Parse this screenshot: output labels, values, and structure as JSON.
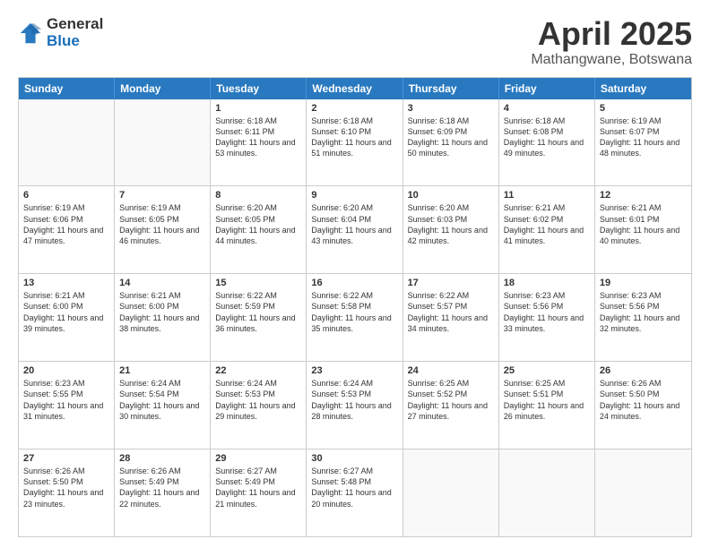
{
  "header": {
    "logo_general": "General",
    "logo_blue": "Blue",
    "month_title": "April 2025",
    "subtitle": "Mathangwane, Botswana"
  },
  "days_of_week": [
    "Sunday",
    "Monday",
    "Tuesday",
    "Wednesday",
    "Thursday",
    "Friday",
    "Saturday"
  ],
  "weeks": [
    [
      {
        "day": "",
        "empty": true
      },
      {
        "day": "",
        "empty": true
      },
      {
        "day": "1",
        "sunrise": "6:18 AM",
        "sunset": "6:11 PM",
        "daylight": "11 hours and 53 minutes."
      },
      {
        "day": "2",
        "sunrise": "6:18 AM",
        "sunset": "6:10 PM",
        "daylight": "11 hours and 51 minutes."
      },
      {
        "day": "3",
        "sunrise": "6:18 AM",
        "sunset": "6:09 PM",
        "daylight": "11 hours and 50 minutes."
      },
      {
        "day": "4",
        "sunrise": "6:18 AM",
        "sunset": "6:08 PM",
        "daylight": "11 hours and 49 minutes."
      },
      {
        "day": "5",
        "sunrise": "6:19 AM",
        "sunset": "6:07 PM",
        "daylight": "11 hours and 48 minutes."
      }
    ],
    [
      {
        "day": "6",
        "sunrise": "6:19 AM",
        "sunset": "6:06 PM",
        "daylight": "11 hours and 47 minutes."
      },
      {
        "day": "7",
        "sunrise": "6:19 AM",
        "sunset": "6:05 PM",
        "daylight": "11 hours and 46 minutes."
      },
      {
        "day": "8",
        "sunrise": "6:20 AM",
        "sunset": "6:05 PM",
        "daylight": "11 hours and 44 minutes."
      },
      {
        "day": "9",
        "sunrise": "6:20 AM",
        "sunset": "6:04 PM",
        "daylight": "11 hours and 43 minutes."
      },
      {
        "day": "10",
        "sunrise": "6:20 AM",
        "sunset": "6:03 PM",
        "daylight": "11 hours and 42 minutes."
      },
      {
        "day": "11",
        "sunrise": "6:21 AM",
        "sunset": "6:02 PM",
        "daylight": "11 hours and 41 minutes."
      },
      {
        "day": "12",
        "sunrise": "6:21 AM",
        "sunset": "6:01 PM",
        "daylight": "11 hours and 40 minutes."
      }
    ],
    [
      {
        "day": "13",
        "sunrise": "6:21 AM",
        "sunset": "6:00 PM",
        "daylight": "11 hours and 39 minutes."
      },
      {
        "day": "14",
        "sunrise": "6:21 AM",
        "sunset": "6:00 PM",
        "daylight": "11 hours and 38 minutes."
      },
      {
        "day": "15",
        "sunrise": "6:22 AM",
        "sunset": "5:59 PM",
        "daylight": "11 hours and 36 minutes."
      },
      {
        "day": "16",
        "sunrise": "6:22 AM",
        "sunset": "5:58 PM",
        "daylight": "11 hours and 35 minutes."
      },
      {
        "day": "17",
        "sunrise": "6:22 AM",
        "sunset": "5:57 PM",
        "daylight": "11 hours and 34 minutes."
      },
      {
        "day": "18",
        "sunrise": "6:23 AM",
        "sunset": "5:56 PM",
        "daylight": "11 hours and 33 minutes."
      },
      {
        "day": "19",
        "sunrise": "6:23 AM",
        "sunset": "5:56 PM",
        "daylight": "11 hours and 32 minutes."
      }
    ],
    [
      {
        "day": "20",
        "sunrise": "6:23 AM",
        "sunset": "5:55 PM",
        "daylight": "11 hours and 31 minutes."
      },
      {
        "day": "21",
        "sunrise": "6:24 AM",
        "sunset": "5:54 PM",
        "daylight": "11 hours and 30 minutes."
      },
      {
        "day": "22",
        "sunrise": "6:24 AM",
        "sunset": "5:53 PM",
        "daylight": "11 hours and 29 minutes."
      },
      {
        "day": "23",
        "sunrise": "6:24 AM",
        "sunset": "5:53 PM",
        "daylight": "11 hours and 28 minutes."
      },
      {
        "day": "24",
        "sunrise": "6:25 AM",
        "sunset": "5:52 PM",
        "daylight": "11 hours and 27 minutes."
      },
      {
        "day": "25",
        "sunrise": "6:25 AM",
        "sunset": "5:51 PM",
        "daylight": "11 hours and 26 minutes."
      },
      {
        "day": "26",
        "sunrise": "6:26 AM",
        "sunset": "5:50 PM",
        "daylight": "11 hours and 24 minutes."
      }
    ],
    [
      {
        "day": "27",
        "sunrise": "6:26 AM",
        "sunset": "5:50 PM",
        "daylight": "11 hours and 23 minutes."
      },
      {
        "day": "28",
        "sunrise": "6:26 AM",
        "sunset": "5:49 PM",
        "daylight": "11 hours and 22 minutes."
      },
      {
        "day": "29",
        "sunrise": "6:27 AM",
        "sunset": "5:49 PM",
        "daylight": "11 hours and 21 minutes."
      },
      {
        "day": "30",
        "sunrise": "6:27 AM",
        "sunset": "5:48 PM",
        "daylight": "11 hours and 20 minutes."
      },
      {
        "day": "",
        "empty": true
      },
      {
        "day": "",
        "empty": true
      },
      {
        "day": "",
        "empty": true
      }
    ]
  ],
  "labels": {
    "sunrise_label": "Sunrise: ",
    "sunset_label": "Sunset: ",
    "daylight_label": "Daylight: "
  }
}
